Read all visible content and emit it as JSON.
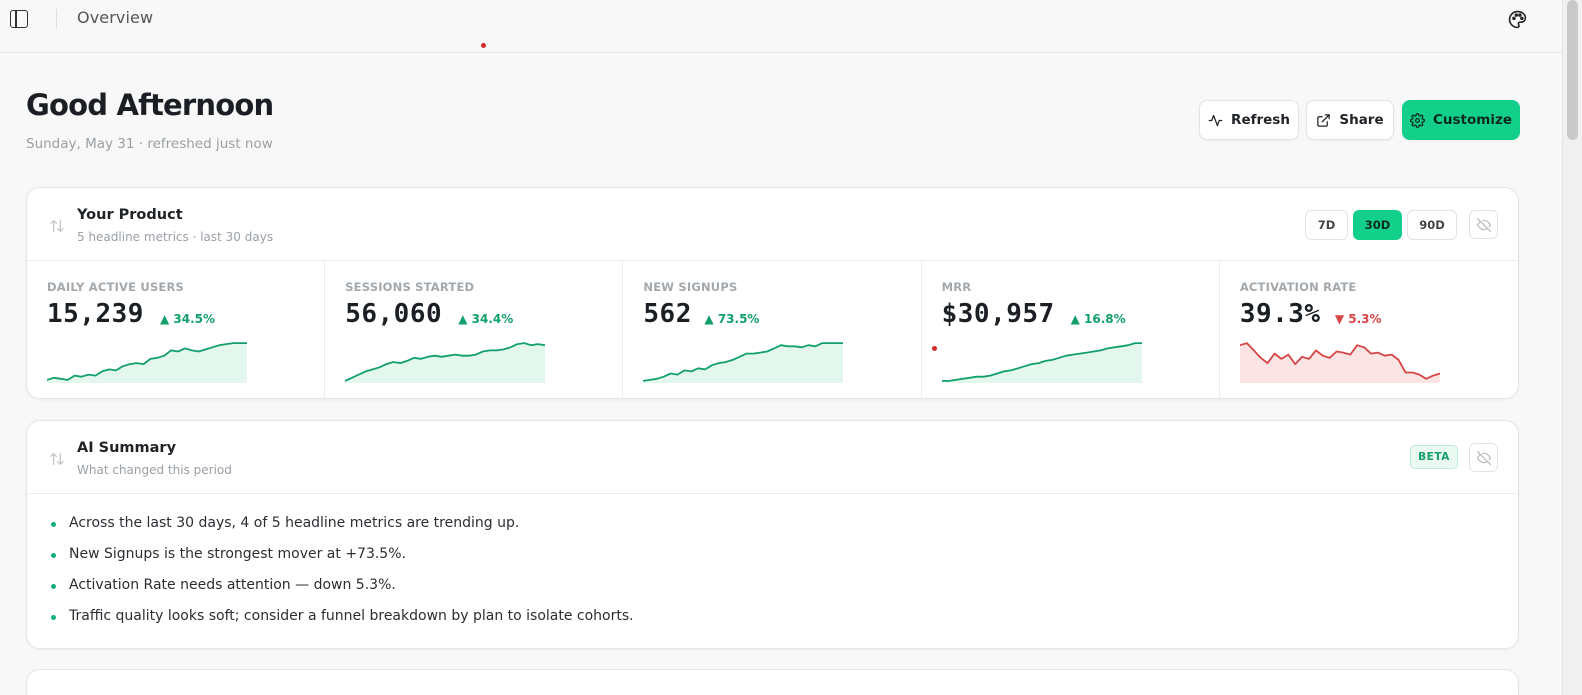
{
  "topbar": {
    "breadcrumb": "Overview",
    "sidebar_toggle_icon": "sidebar-toggle-icon",
    "theme_icon": "palette-icon"
  },
  "header": {
    "greeting": "Good Afternoon",
    "subline": "Sunday, May 31 · refreshed just now",
    "buttons": {
      "refresh": "Refresh",
      "share": "Share",
      "customize": "Customize"
    }
  },
  "product_card": {
    "title": "Your Product",
    "subtitle": "5 headline metrics · last 30 days",
    "ranges": [
      "7D",
      "30D",
      "90D"
    ],
    "active_range": "30D",
    "metrics": [
      {
        "label": "DAILY ACTIVE USERS",
        "value": "15,239",
        "delta": "▲ 34.5%",
        "trend": "up",
        "series": [
          3,
          5,
          4,
          3,
          7,
          6,
          8,
          7,
          11,
          13,
          12,
          16,
          18,
          19,
          18,
          23,
          24,
          26,
          31,
          30,
          33,
          31,
          30,
          32,
          34,
          36,
          37,
          38,
          38,
          38
        ]
      },
      {
        "label": "SESSIONS STARTED",
        "value": "56,060",
        "delta": "▲ 34.4%",
        "trend": "up",
        "series": [
          2,
          5,
          8,
          11,
          13,
          15,
          18,
          20,
          19,
          21,
          24,
          23,
          25,
          26,
          25,
          26,
          27,
          26,
          26,
          27,
          30,
          31,
          31,
          32,
          34,
          37,
          38,
          36,
          37,
          36
        ]
      },
      {
        "label": "NEW SIGNUPS",
        "value": "562",
        "delta": "▲ 73.5%",
        "trend": "up",
        "series": [
          2,
          3,
          4,
          6,
          9,
          8,
          12,
          11,
          14,
          13,
          17,
          19,
          20,
          22,
          25,
          28,
          28,
          29,
          30,
          33,
          36,
          35,
          35,
          34,
          36,
          35,
          38,
          38,
          38,
          38
        ]
      },
      {
        "label": "MRR",
        "value": "$30,957",
        "delta": "▲ 16.8%",
        "trend": "up",
        "series": [
          2,
          2,
          3,
          4,
          5,
          6,
          6,
          7,
          9,
          11,
          12,
          14,
          16,
          18,
          19,
          21,
          22,
          24,
          26,
          27,
          28,
          29,
          30,
          31,
          33,
          34,
          35,
          36,
          38,
          38
        ]
      },
      {
        "label": "ACTIVATION RATE",
        "value": "39.3%",
        "delta": "▼ 5.3%",
        "trend": "down",
        "series": [
          36,
          38,
          31,
          24,
          19,
          28,
          23,
          27,
          18,
          25,
          23,
          31,
          26,
          24,
          30,
          29,
          27,
          36,
          34,
          28,
          29,
          26,
          27,
          22,
          10,
          10,
          8,
          4,
          7,
          9
        ]
      }
    ]
  },
  "summary_card": {
    "title": "AI Summary",
    "subtitle": "What changed this period",
    "badge": "BETA",
    "bullets": [
      "Across the last 30 days, 4 of 5 headline metrics are trending up.",
      "New Signups is the strongest mover at +73.5%.",
      "Activation Rate needs attention — down 5.3%.",
      "Traffic quality looks soft; consider a funnel breakdown by plan to isolate cohorts."
    ]
  },
  "colors": {
    "accent": "#12cf8a",
    "up": "#12a06a",
    "down": "#d64545",
    "up_fill": "#e3f7ee",
    "down_fill": "#fde4e4"
  }
}
